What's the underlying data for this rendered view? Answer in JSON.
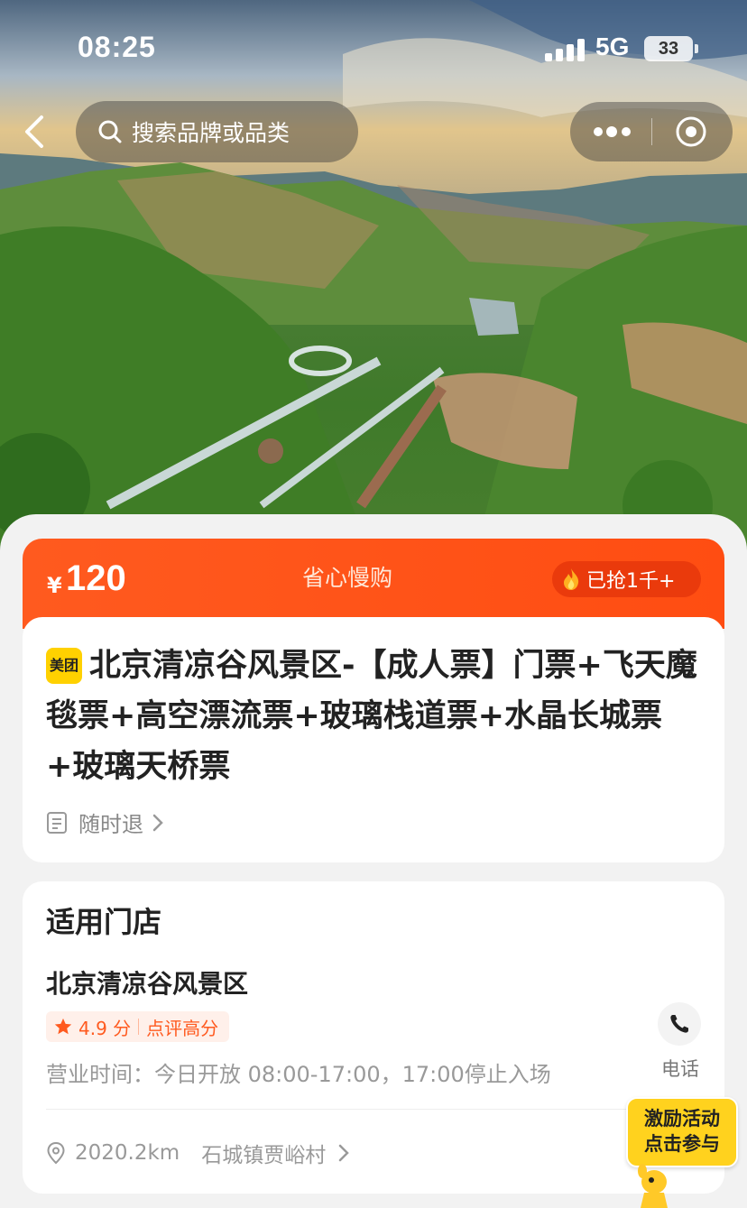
{
  "status_bar": {
    "time": "08:25",
    "network": "5G",
    "battery": "33"
  },
  "nav": {
    "back_icon": "chevron-left-icon",
    "search_placeholder": "搜索品牌或品类",
    "more_icon": "more-dots-icon",
    "target_icon": "target-icon"
  },
  "price_bar": {
    "currency": "¥",
    "price": "120",
    "slogan": "省心慢购",
    "sold": "已抢1千+",
    "accent_color": "#ff4d12"
  },
  "product": {
    "badge": "美团",
    "title": "北京清凉谷风景区-【成人票】门票+飞天魔毯票+高空漂流票+玻璃栈道票+水晶长城票+玻璃天桥票",
    "refund_label": "随时退"
  },
  "store": {
    "section_title": "适用门店",
    "name": "北京清凉谷风景区",
    "rating": "4.9 分",
    "rating_tag": "点评高分",
    "hours": "营业时间：今日开放 08:00-17:00，17:00停止入场",
    "phone_label": "电话",
    "distance": "2020.2km",
    "address": "石城镇贾峪村"
  },
  "promo": {
    "line1": "激励活动",
    "line2": "点击参与"
  }
}
